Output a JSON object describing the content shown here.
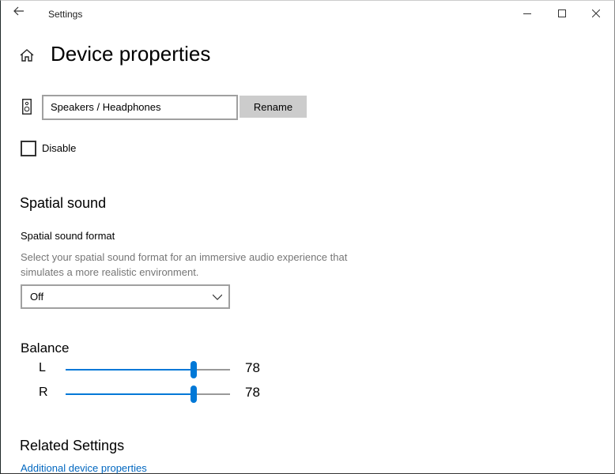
{
  "window": {
    "title": "Settings",
    "back_icon": "arrow-left",
    "controls": [
      "minimize",
      "maximize",
      "close"
    ]
  },
  "page": {
    "title": "Device properties",
    "home_icon": "home"
  },
  "device": {
    "icon": "speaker",
    "name": "Speakers / Headphones",
    "rename_label": "Rename",
    "disable_label": "Disable",
    "disabled": false
  },
  "spatial": {
    "heading": "Spatial sound",
    "format_label": "Spatial sound format",
    "description": "Select your spatial sound format for an immersive audio experience that simulates a more realistic environment.",
    "selected": "Off"
  },
  "balance": {
    "heading": "Balance",
    "channels": [
      {
        "label": "L",
        "value": "78"
      },
      {
        "label": "R",
        "value": "78"
      }
    ]
  },
  "related": {
    "heading": "Related Settings",
    "link": "Additional device properties"
  },
  "colors": {
    "accent": "#0078d7",
    "link": "#0067c0",
    "button": "#cccccc"
  }
}
